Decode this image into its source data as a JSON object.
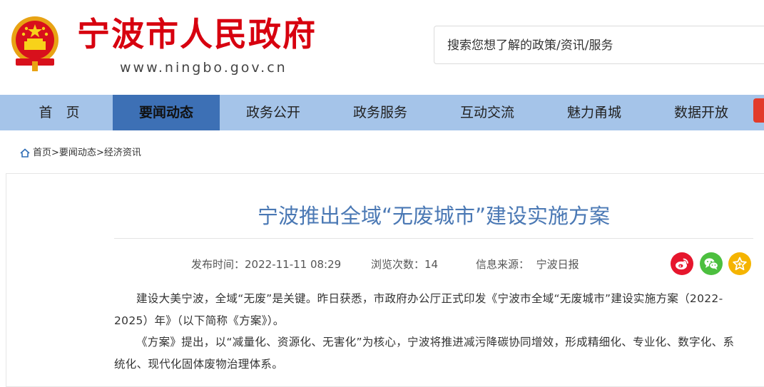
{
  "header": {
    "site_title": "宁波市人民政府",
    "site_url": "www.ningbo.gov.cn",
    "search_placeholder": "搜索您想了解的政策/资讯/服务"
  },
  "nav": {
    "items": [
      "首　页",
      "要闻动态",
      "政务公开",
      "政务服务",
      "互动交流",
      "魅力甬城",
      "数据开放"
    ],
    "active_index": 1
  },
  "breadcrumb": {
    "items": [
      "首页",
      "要闻动态",
      "经济资讯"
    ],
    "separator": ">"
  },
  "article": {
    "title": "宁波推出全域“无废城市”建设实施方案",
    "publish_label": "发布时间：",
    "publish_time": "2022-11-11 08:29",
    "views_label": "浏览次数：",
    "views": "14",
    "source_label": "信息来源：",
    "source": "宁波日报",
    "para1_line1": "建设大美宁波，全域“无废”是关键。昨日获悉，市政府办公厅正式印发《宁波市全域“无废城市”建设实施方案（2022-",
    "para1_line2": "2025）年》（以下简称《方案》）。",
    "para2_line1": "《方案》提出，以“减量化、资源化、无害化”为核心，宁波将推进减污降碳协同增效，形成精细化、专业化、数字化、系",
    "para2_line2": "统化、现代化固体废物治理体系。"
  },
  "share_icons": [
    "weibo-icon",
    "wechat-icon",
    "favorite-icon"
  ],
  "colors": {
    "brand_red": "#d7000f",
    "nav_bg": "#a5c4e9",
    "nav_active": "#3d70b5",
    "title_blue": "#4a78b4",
    "weibo": "#e6162d",
    "wechat": "#4cbf3f",
    "favorite": "#f5b400"
  }
}
